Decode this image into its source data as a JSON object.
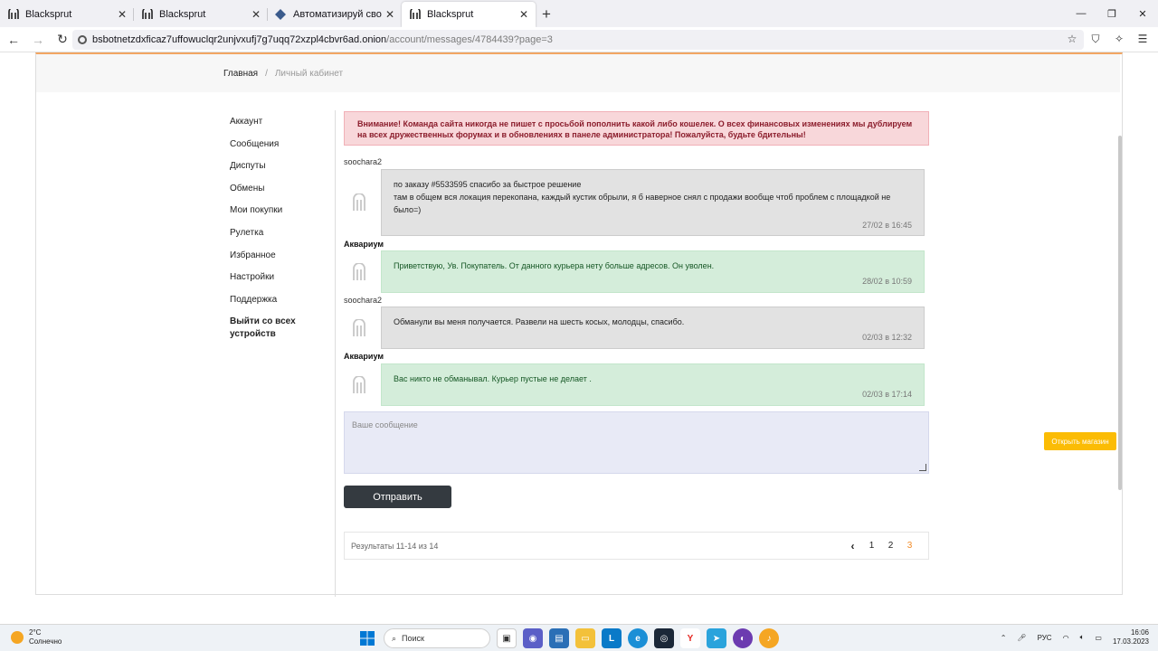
{
  "browser": {
    "tabs": [
      {
        "title": "Blacksprut",
        "active": false
      },
      {
        "title": "Blacksprut",
        "active": false
      },
      {
        "title": "Автоматизируй свой бизнес с",
        "active": false
      },
      {
        "title": "Blacksprut",
        "active": true
      }
    ],
    "url_host": "bsbotnetzdxficaz7uffowuclqr2unjvxufj7g7uqq72xzpl4cbvr6ad.onion",
    "url_path": "/account/messages/4784439?page=3"
  },
  "breadcrumb": {
    "home": "Главная",
    "separator": "/",
    "current": "Личный кабинет"
  },
  "sidebar": {
    "items": [
      {
        "label": "Аккаунт"
      },
      {
        "label": "Сообщения"
      },
      {
        "label": "Диспуты"
      },
      {
        "label": "Обмены"
      },
      {
        "label": "Мои покупки"
      },
      {
        "label": "Рулетка"
      },
      {
        "label": "Избранное"
      },
      {
        "label": "Настройки"
      },
      {
        "label": "Поддержка"
      }
    ],
    "logout_line1": "Выйти со всех",
    "logout_line2": "устройств"
  },
  "alert": {
    "text": "Внимание! Команда сайта никогда не пишет с просьбой пополнить какой либо кошелек. О всех финансовых изменениях мы дублируем на всех дружественных форумах и в обновлениях в панеле администратора! Пожалуйста, будьте бдительны!"
  },
  "messages": [
    {
      "author": "soochara2",
      "lines": [
        "по заказу #5533595 спасибо за быстрое решение",
        "там в общем вся локация перекопана, каждый кустик обрыли, я б наверное снял с продажи вообще чтоб проблем с площадкой не было=)"
      ],
      "time": "27/02 в 16:45"
    },
    {
      "author": "Аквариум",
      "lines": [
        "Приветствую, Ув. Покупатель. От данного курьера нету больше адресов. Он уволен."
      ],
      "time": "28/02 в 10:59"
    },
    {
      "author": "soochara2",
      "lines": [
        "Обманули вы меня получается. Развели на шесть косых, молодцы, спасибо."
      ],
      "time": "02/03 в 12:32"
    },
    {
      "author": "Аквариум",
      "lines": [
        "Вас никто не обманывал. Курьер пустые не делает ."
      ],
      "time": "02/03 в 17:14"
    }
  ],
  "composer": {
    "placeholder": "Ваше сообщение",
    "send_label": "Отправить"
  },
  "pagination": {
    "summary": "Результаты 11-14 из 14",
    "prev": "‹",
    "pages": [
      "1",
      "2",
      "3"
    ],
    "current": "3"
  },
  "shop_button": "Открыть магазин",
  "taskbar": {
    "temp": "2°C",
    "weather": "Солнечно",
    "search": "Поиск",
    "lang": "РУС",
    "time": "16:06",
    "date": "17.03.2023"
  }
}
